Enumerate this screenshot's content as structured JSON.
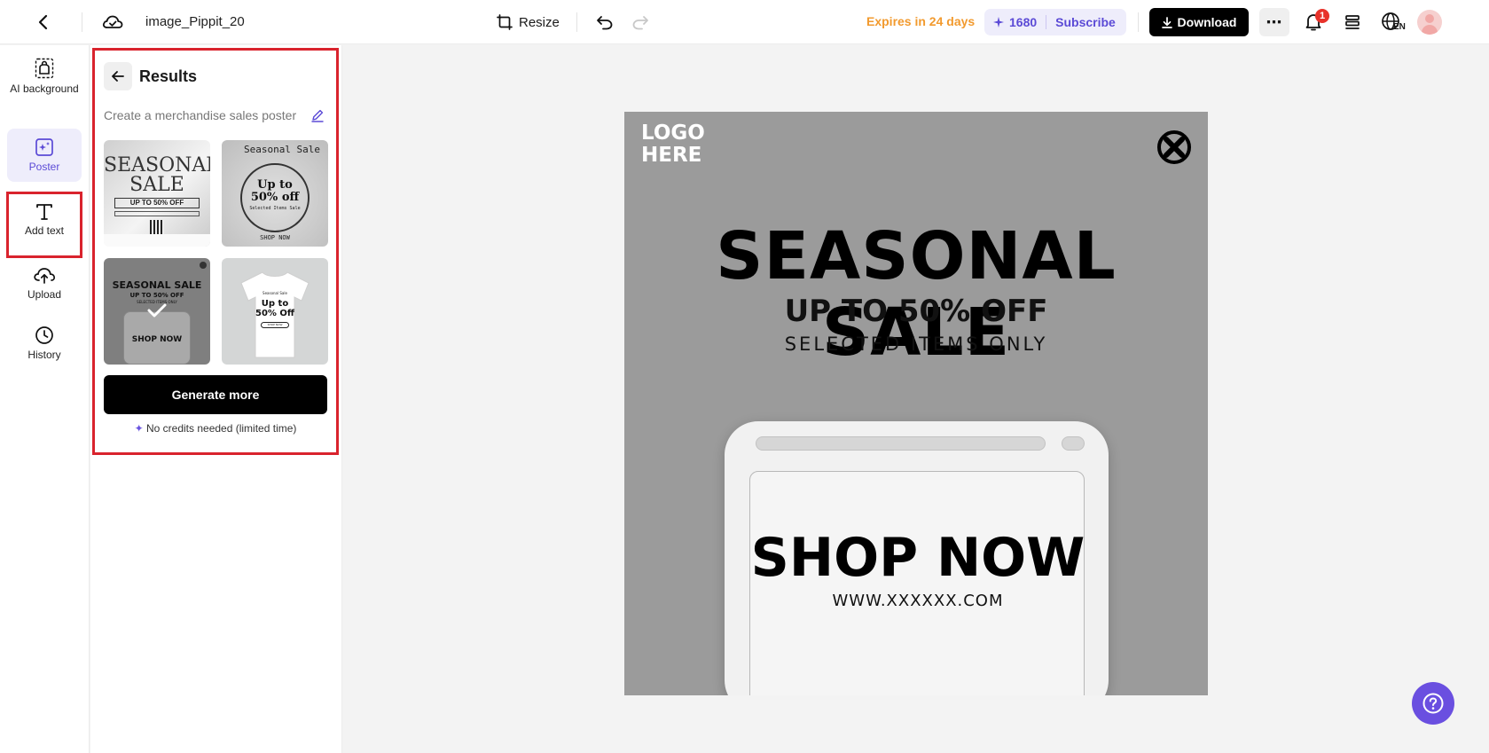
{
  "topbar": {
    "filename": "image_Pippit_20",
    "resize_label": "Resize",
    "expires": "Expires in 24 days",
    "credits": "1680",
    "subscribe_label": "Subscribe",
    "download_label": "Download",
    "notification_count": "1",
    "language": "EN"
  },
  "rail": {
    "items": [
      {
        "label": "AI background",
        "icon": "ai-background-icon"
      },
      {
        "label": "Poster",
        "icon": "poster-icon"
      },
      {
        "label": "Add text",
        "icon": "text-icon"
      },
      {
        "label": "Upload",
        "icon": "upload-icon"
      },
      {
        "label": "History",
        "icon": "history-icon"
      }
    ]
  },
  "panel": {
    "title": "Results",
    "prompt": "Create a merchandise sales poster",
    "generate_label": "Generate more",
    "note": "No credits needed (limited time)",
    "thumbnails": [
      {
        "line1": "SEASONAL",
        "line2": "SALE",
        "line3": "UP TO 50% OFF"
      },
      {
        "head": "Seasonal Sale",
        "line1": "Up to",
        "line2": "50% off",
        "line3": "Selected Items Sale",
        "cta": "SHOP NOW"
      },
      {
        "line1": "SEASONAL SALE",
        "line2": "UP TO 50% OFF",
        "line3": "SELECTED ITEMS ONLY",
        "cta": "SHOP NOW"
      },
      {
        "line0": "Seasonal Sale",
        "line1": "Up to",
        "line2": "50% Off",
        "cta": "SHOP NOW"
      }
    ]
  },
  "canvas": {
    "logo_line1": "LOGO",
    "logo_line2": "HERE",
    "title": "SEASONAL SALE",
    "subtitle": "UP TO 50% OFF",
    "subtitle2": "SELECTED ITEMS ONLY",
    "cta": "SHOP NOW",
    "url": "WWW.XXXXXX.COM"
  },
  "colors": {
    "accent": "#5b4ad6",
    "expires": "#f29a2e",
    "highlight": "#d9232d",
    "canvas_bg": "#9b9b9b"
  }
}
